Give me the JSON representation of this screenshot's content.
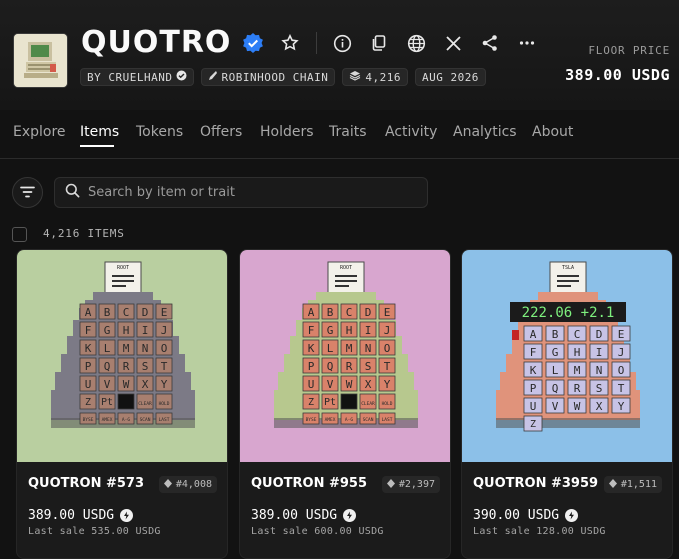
{
  "collection": {
    "title": "QUOTRO…",
    "chips": {
      "creator": "BY CRUELHAND",
      "chain": "ROBINHOOD CHAIN",
      "supply": "4,216",
      "date": "AUG 2026"
    },
    "floor_label": "FLOOR PRICE",
    "floor_value": "389.00 USDG"
  },
  "tabs": [
    {
      "label": "Explore"
    },
    {
      "label": "Items"
    },
    {
      "label": "Tokens"
    },
    {
      "label": "Offers"
    },
    {
      "label": "Holders"
    },
    {
      "label": "Traits"
    },
    {
      "label": "Activity"
    },
    {
      "label": "Analytics"
    },
    {
      "label": "About"
    }
  ],
  "active_tab": "Items",
  "search": {
    "placeholder": "Search by item or trait"
  },
  "items_count": "4,216 ITEMS",
  "cards": [
    {
      "name": "QUOTRON #573",
      "rank": "#4,008",
      "price": "389.00 USDG",
      "last_sale": "Last sale 535.00 USDG",
      "bg": "#b9cfa0",
      "body": "#7c7a86",
      "keys": "#a87f6f",
      "paper_label": "ROOT",
      "screen": "",
      "dark_key": "#111111",
      "letters": [
        "A",
        "B",
        "C",
        "D",
        "E",
        "F",
        "G",
        "H",
        "I",
        "J",
        "K",
        "L",
        "M",
        "N",
        "O",
        "P",
        "Q",
        "R",
        "S",
        "T",
        "U",
        "V",
        "W",
        "X",
        "Y"
      ],
      "bottom_row": [
        "Z",
        "Pt",
        "",
        "CLEAR",
        "HOLD"
      ],
      "fn_row": [
        "BYSE",
        "AMEX",
        "A-G",
        "SCAN",
        "LAST"
      ]
    },
    {
      "name": "QUOTRON #955",
      "rank": "#2,397",
      "price": "389.00 USDG",
      "last_sale": "Last sale 600.00 USDG",
      "bg": "#d8a6cf",
      "body": "#b7c88e",
      "keys": "#d9826a",
      "paper_label": "ROOT",
      "screen": "",
      "dark_key": "#111111",
      "letters": [
        "A",
        "B",
        "C",
        "D",
        "E",
        "F",
        "G",
        "H",
        "I",
        "J",
        "K",
        "L",
        "M",
        "N",
        "O",
        "P",
        "Q",
        "R",
        "S",
        "T",
        "U",
        "V",
        "W",
        "X",
        "Y"
      ],
      "bottom_row": [
        "Z",
        "Pt",
        "",
        "CLEAR",
        "HOLD"
      ],
      "fn_row": [
        "BYSE",
        "AMEX",
        "A-G",
        "SCAN",
        "LAST"
      ]
    },
    {
      "name": "QUOTRON #3959",
      "rank": "#1,511",
      "price": "390.00 USDG",
      "last_sale": "Last sale 128.00 USDG",
      "bg": "#8cc0e8",
      "body": "#e0937b",
      "keys": "#c7c3e6",
      "paper_label": "TSLA",
      "screen": "222.06 +2.1",
      "dark_key": "#c42424",
      "letters": [
        "A",
        "B",
        "C",
        "D",
        "E",
        "F",
        "G",
        "H",
        "I",
        "J",
        "K",
        "L",
        "M",
        "N",
        "O",
        "P",
        "Q",
        "R",
        "S",
        "T",
        "U",
        "V",
        "W",
        "X",
        "Y"
      ],
      "bottom_row": [
        "Z",
        "",
        "",
        "",
        ""
      ],
      "fn_row": []
    }
  ]
}
